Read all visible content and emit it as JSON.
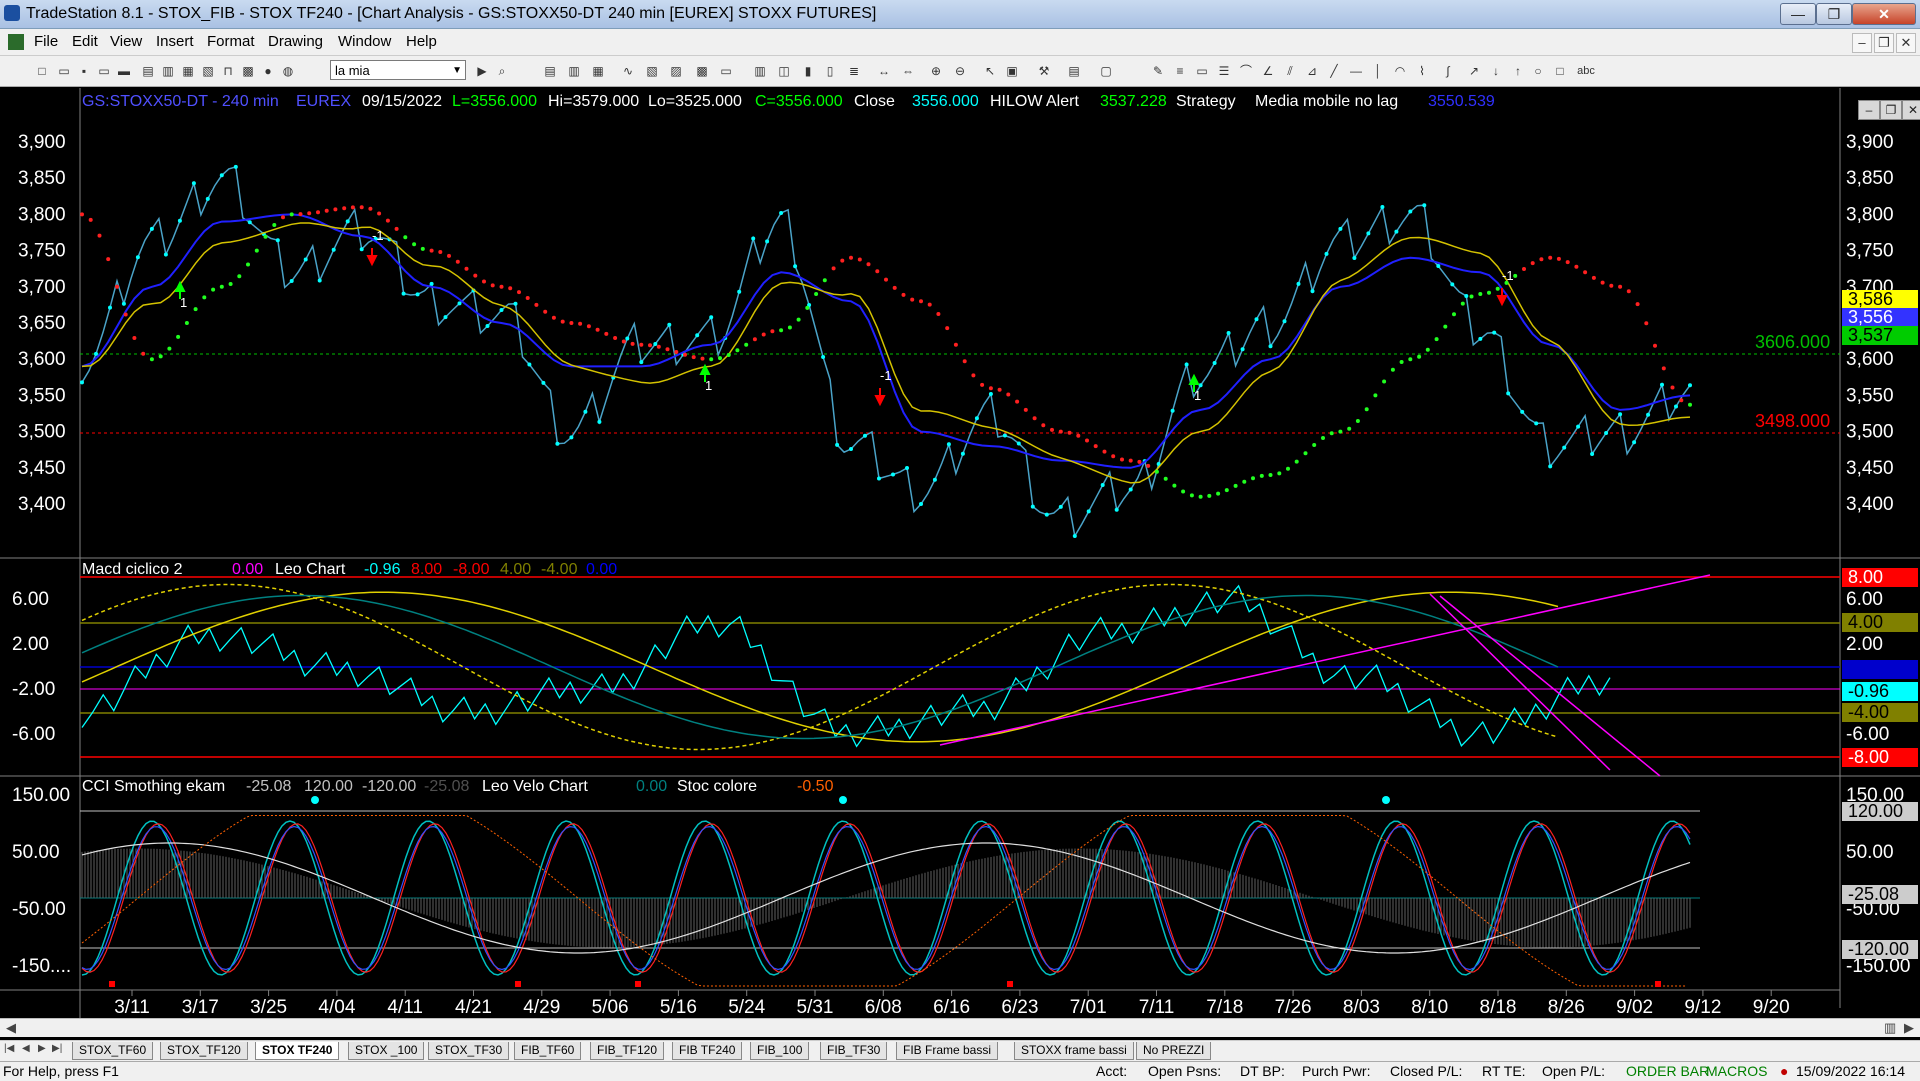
{
  "window": {
    "title": "TradeStation 8.1 - STOX_FIB - STOX TF240 - [Chart Analysis - GS:STOXX50-DT  240 min  [EUREX] STOXX FUTURES]",
    "minimize": "—",
    "maximize": "❐",
    "close": "✕"
  },
  "menu": {
    "items": [
      "File",
      "Edit",
      "View",
      "Insert",
      "Format",
      "Drawing",
      "Window",
      "Help"
    ],
    "mdi": [
      "–",
      "❐",
      "✕"
    ]
  },
  "toolbar": {
    "workspace_select": "la mia",
    "icons": [
      "new-icon",
      "open-icon",
      "save-icon",
      "lock-icon",
      "print-icon",
      "grid-icon",
      "zoom-in-icon",
      "zoom-out-icon",
      "cursor-icon",
      "drawing-icon",
      "hammer-icon",
      "line-icon",
      "arrow-icon",
      "ellipse-icon",
      "rectangle-icon",
      "text-icon"
    ],
    "text_tool": "abc"
  },
  "chart": {
    "header": {
      "symbol": "GS:STOXX50-DT - 240 min",
      "exchange": "EUREX",
      "date": "09/15/2022",
      "low": "L=3556.000",
      "hi": "Hi=3579.000",
      "lo": "Lo=3525.000",
      "close_c": "C=3556.000",
      "close_label": "Close",
      "close_val": "3556.000",
      "hilow_label": "HILOW Alert",
      "hilow_val": "3537.228",
      "strategy_label": "Strategy",
      "media_label": "Media mobile no lag",
      "media_val": "3550.539"
    },
    "price_axis": [
      "3,900",
      "3,850",
      "3,800",
      "3,750",
      "3,700",
      "3,650",
      "3,600",
      "3,550",
      "3,500",
      "3,450",
      "3,400"
    ],
    "levels": {
      "upper": "3606.000",
      "lower": "3498.000"
    },
    "right_tags": [
      {
        "text": "3,586",
        "bg": "#ffff00",
        "fg": "#000000"
      },
      {
        "text": "3,556",
        "bg": "#3333ff",
        "fg": "#ffffff"
      },
      {
        "text": "3,537",
        "bg": "#00cc00",
        "fg": "#000000"
      }
    ],
    "x_axis": [
      "3/11",
      "3/17",
      "3/25",
      "4/04",
      "4/11",
      "4/21",
      "4/29",
      "5/06",
      "5/16",
      "5/24",
      "5/31",
      "6/08",
      "6/16",
      "6/23",
      "7/01",
      "7/11",
      "7/18",
      "7/26",
      "8/03",
      "8/10",
      "8/18",
      "8/26",
      "9/02",
      "9/12",
      "9/20"
    ],
    "markers": {
      "sell": "-1",
      "buy": "1"
    }
  },
  "macd": {
    "name": "Macd ciclico 2",
    "v1": "0.00",
    "leo_label": "Leo Chart",
    "v2": "-0.96",
    "v3": "8.00",
    "v4": "-8.00",
    "v5": "4.00",
    "v6": "-4.00",
    "v7": "0.00",
    "axis": [
      "6.00",
      "2.00",
      "-2.00",
      "-6.00"
    ],
    "right_axis": [
      "6.00",
      "2.00",
      "-6.00"
    ],
    "tags": [
      {
        "text": "8.00",
        "bg": "#ff0000",
        "fg": "#ffffff"
      },
      {
        "text": "4.00",
        "bg": "#808000",
        "fg": "#000000"
      },
      {
        "text": "0.00",
        "bg": "#0000cc",
        "fg": "#0000cc"
      },
      {
        "text": "-0.96",
        "bg": "#00ffff",
        "fg": "#000000"
      },
      {
        "text": "-4.00",
        "bg": "#808000",
        "fg": "#000000"
      },
      {
        "text": "-8.00",
        "bg": "#ff0000",
        "fg": "#ffffff"
      }
    ]
  },
  "cci": {
    "name": "CCI Smothing ekam",
    "v1": "-25.08",
    "v2": "120.00",
    "v3": "-120.00",
    "v4": "-25.08",
    "velo_label": "Leo Velo Chart",
    "v5": "0.00",
    "stoc_label": "Stoc colore",
    "v6": "-0.50",
    "axis": [
      "150.00",
      "50.00",
      "-50.00",
      "-150...."
    ],
    "right_axis": [
      "150.00",
      "50.00",
      "-50.00",
      "-150.00"
    ],
    "tags": [
      {
        "text": "120.00",
        "bg": "#cccccc",
        "fg": "#000000"
      },
      {
        "text": "-25.08",
        "bg": "#cccccc",
        "fg": "#000000"
      },
      {
        "text": "-120.00",
        "bg": "#cccccc",
        "fg": "#000000"
      }
    ]
  },
  "tabs": [
    "STOX_TF60",
    "STOX_TF120",
    "STOX TF240",
    "STOX _100",
    "STOX_TF30",
    "FIB_TF60",
    "FIB_TF120",
    "FIB TF240",
    "FIB_100",
    "FIB_TF30",
    "FIB Frame bassi",
    "STOXX frame bassi",
    "No PREZZI"
  ],
  "active_tab": "STOX TF240",
  "status": {
    "help": "For Help, press F1",
    "acct": "Acct:",
    "open_psns": "Open Psns:",
    "dt_bp": "DT BP:",
    "purch_pwr": "Purch Pwr:",
    "closed_pl": "Closed P/L:",
    "rt_te": "RT TE:",
    "open_pl": "Open P/L:",
    "order_bar": "ORDER BAR",
    "macros": "MACROS",
    "datetime": "15/09/2022 16:14"
  },
  "chart_data": [
    {
      "type": "line",
      "title": "GS:STOXX50-DT - 240 min",
      "x": [
        "3/11",
        "3/17",
        "3/25",
        "4/04",
        "4/11",
        "4/21",
        "4/29",
        "5/06",
        "5/16",
        "5/24",
        "5/31",
        "6/08",
        "6/16",
        "6/23",
        "7/01",
        "7/11",
        "7/18",
        "7/26",
        "8/03",
        "8/10",
        "8/18",
        "8/26",
        "9/02",
        "9/12"
      ],
      "series": [
        {
          "name": "Close",
          "values": [
            3600,
            3760,
            3850,
            3720,
            3780,
            3680,
            3660,
            3500,
            3620,
            3630,
            3790,
            3480,
            3420,
            3520,
            3380,
            3420,
            3580,
            3650,
            3760,
            3800,
            3640,
            3480,
            3500,
            3556
          ]
        },
        {
          "name": "Media mobile no lag",
          "values": [
            3590,
            3700,
            3790,
            3800,
            3770,
            3700,
            3650,
            3590,
            3590,
            3620,
            3720,
            3680,
            3500,
            3480,
            3460,
            3450,
            3530,
            3600,
            3700,
            3740,
            3720,
            3620,
            3530,
            3550
          ]
        },
        {
          "name": "HILOW Alert",
          "values": [
            3800,
            3600,
            3700,
            3800,
            3810,
            3750,
            3700,
            3650,
            3620,
            3600,
            3640,
            3740,
            3680,
            3560,
            3500,
            3460,
            3410,
            3440,
            3500,
            3600,
            3690,
            3740,
            3700,
            3537
          ]
        }
      ],
      "levels": [
        3606,
        3498
      ],
      "ylim": [
        3350,
        3920
      ]
    },
    {
      "type": "line",
      "title": "Macd ciclico 2",
      "x": [
        "3/11",
        "3/25",
        "4/11",
        "4/29",
        "5/16",
        "5/31",
        "6/16",
        "7/01",
        "7/18",
        "8/03",
        "8/18",
        "9/02",
        "9/12"
      ],
      "series": [
        {
          "name": "Leo Chart",
          "values": [
            -4,
            3,
            0,
            -4,
            -2,
            4,
            -6,
            -4,
            3,
            6,
            -1,
            -6,
            -0.96
          ]
        }
      ],
      "levels": [
        8,
        4,
        0,
        -4,
        -8
      ],
      "ylim": [
        -9,
        9
      ]
    },
    {
      "type": "line",
      "title": "CCI Smothing ekam",
      "x": [
        "3/11",
        "3/25",
        "4/11",
        "4/29",
        "5/16",
        "5/31",
        "6/16",
        "7/01",
        "7/18",
        "8/03",
        "8/18",
        "9/02",
        "9/12"
      ],
      "series": [
        {
          "name": "Leo Velo Chart",
          "values": [
            -150,
            80,
            -120,
            100,
            -150,
            120,
            -140,
            90,
            -130,
            120,
            -140,
            -150,
            -25.08
          ]
        }
      ],
      "levels": [
        120,
        -25.08,
        -120
      ],
      "ylim": [
        -180,
        170
      ]
    }
  ]
}
